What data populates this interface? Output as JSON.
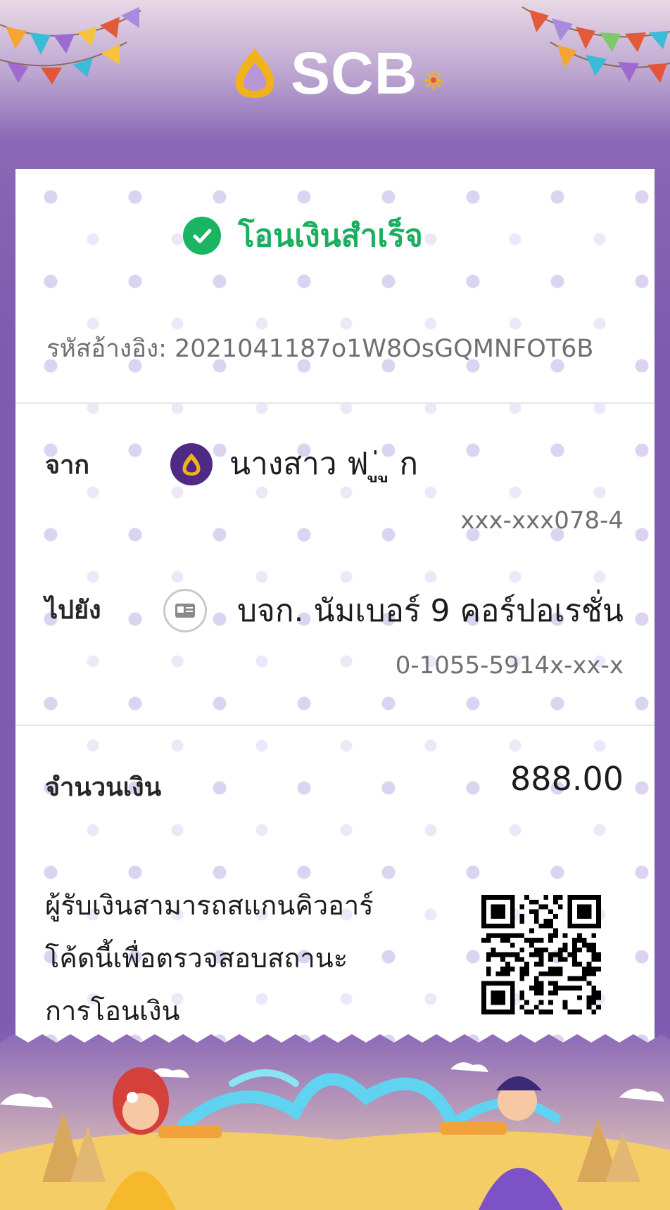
{
  "header": {
    "brand": "SCB",
    "colors": {
      "brand_purple": "#4e2a84",
      "brand_gold": "#f2b21c",
      "success_green": "#1bb463"
    }
  },
  "receipt": {
    "status_title": "โอนเงินสำเร็จ",
    "status_icon": "check-circle-icon",
    "reference": "รหัสอ้างอิง: 2021041187o1W8OsGQMNFOT6B",
    "from": {
      "label": "จาก",
      "name": "นางสาว ฟ                ู่        ู       ก",
      "account": "xxx-xxx078-4",
      "icon": "scb-logo-icon"
    },
    "to": {
      "label": "ไปยัง",
      "name": "บจก. นัมเบอร์ 9 คอร์ปอเรชั่น",
      "account": "0-1055-5914x-xx-x",
      "icon": "id-card-icon"
    },
    "amount": {
      "label": "จำนวนเงิน",
      "value": "888.00"
    },
    "note_lines": [
      "ผู้รับเงินสามารถสแกนคิวอาร์",
      "โค้ดนี้เพื่อตรวจสอบสถานะ",
      "การโอนเงิน"
    ],
    "qr_icon": "qr-code-icon"
  }
}
